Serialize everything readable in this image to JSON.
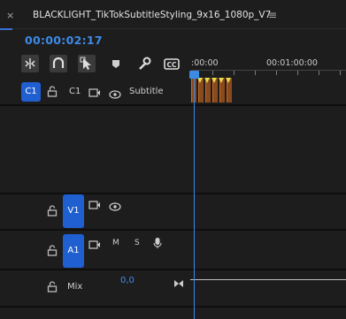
{
  "tab": {
    "close_glyph": "×",
    "title": "BLACKLIGHT_TikTokSubtitleStyling_9x16_1080p_V7",
    "menu_glyph": "≡"
  },
  "timecode": "00:00:02:17",
  "toolbar": {
    "icons": [
      "snap-icon",
      "magnet-icon",
      "linked-selection-icon",
      "marker-icon",
      "wrench-icon",
      "captions-icon"
    ],
    "cc_label": "CC"
  },
  "ruler": {
    "start_label": ":00:00",
    "mid_label": "00:01:00:00"
  },
  "tracks": {
    "c1": {
      "toggle_label": "C1",
      "name": "C1",
      "label": "Subtitle"
    },
    "v1": {
      "label": "V1"
    },
    "a1": {
      "label": "A1",
      "mute": "M",
      "solo": "S"
    },
    "mix": {
      "label": "Mix",
      "value": "0,0"
    }
  },
  "colors": {
    "accent": "#3b8ae6",
    "track_target": "#1f5fd0",
    "clip": "#8a4a1c",
    "marker": "#e8d84a"
  }
}
